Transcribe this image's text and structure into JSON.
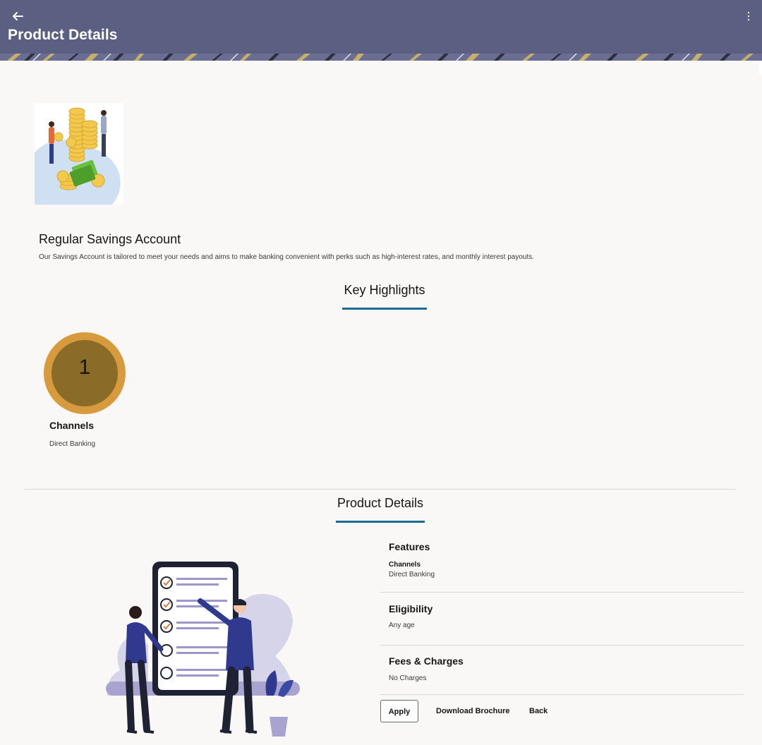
{
  "header": {
    "title": "Product Details",
    "back_icon": "back-arrow-icon",
    "menu_icon": "kebab-menu-icon",
    "background_color": "#5b5f82"
  },
  "product": {
    "name": "Regular Savings Account",
    "description": "Our Savings Account is tailored to meet your needs and aims to make banking convenient with perks such as high-interest rates, and monthly interest payouts.",
    "image_icon": "savings-coins-illustration"
  },
  "key_highlights": {
    "title": "Key Highlights",
    "items": [
      {
        "number": "1",
        "title": "Channels",
        "value": "Direct Banking"
      }
    ]
  },
  "product_details": {
    "title": "Product Details",
    "illustration_icon": "checklist-illustration",
    "sections": [
      {
        "title": "Features",
        "subtitle": "Channels",
        "value": "Direct Banking"
      },
      {
        "title": "Eligibility",
        "value": "Any age"
      },
      {
        "title": "Fees & Charges",
        "value": "No Charges"
      }
    ]
  },
  "actions": {
    "apply_label": "Apply",
    "download_label": "Download Brochure",
    "back_label": "Back"
  },
  "colors": {
    "accent": "#1c6b94",
    "highlight_outer": "#d79a3c",
    "highlight_inner": "#8b6b28"
  }
}
